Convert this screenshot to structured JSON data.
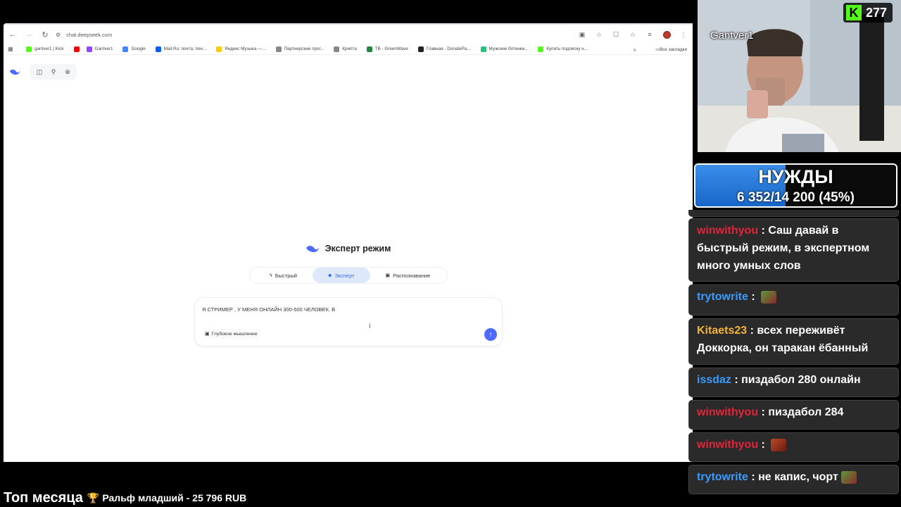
{
  "browser": {
    "url": "chat.deepseek.com",
    "bookmarks": [
      {
        "label": "gantver1 | Kick",
        "color": "#53fc18"
      },
      {
        "label": "",
        "color": "#ff0000"
      },
      {
        "label": "Gantver1",
        "color": "#9146ff"
      },
      {
        "label": "Google",
        "color": "#4285f4"
      },
      {
        "label": "Mail.Ru: почта, пои...",
        "color": "#005ff9"
      },
      {
        "label": "Яндекс Музыка —...",
        "color": "#ffcc00"
      },
      {
        "label": "Партнерские прог...",
        "color": "#888888"
      },
      {
        "label": "Крипта",
        "color": "#888888"
      },
      {
        "label": "TB - GreenWave",
        "color": "#1f8a3d"
      },
      {
        "label": "Главная - DonatePa...",
        "color": "#222222"
      },
      {
        "label": "Мужские ботинки...",
        "color": "#26c281"
      },
      {
        "label": "Купить подписку н...",
        "color": "#53fc18"
      }
    ],
    "all_bookmarks": "Все закладки"
  },
  "deepseek": {
    "hero_title": "Эксперт режим",
    "modes": [
      {
        "label": "Быстрый",
        "icon": "lightning-icon",
        "active": false
      },
      {
        "label": "Эксперт",
        "icon": "diamond-icon",
        "active": true
      },
      {
        "label": "Распознавание",
        "icon": "image-icon",
        "active": false
      }
    ],
    "composer_text": "Я СТРИМЕР , У МЕНЯ ОНЛАЙН 300-500 ЧЕЛОВЕК. В",
    "deep_thinking": "Глубокое мышление",
    "send_color": "#4d6bfe"
  },
  "stream": {
    "streamer_name": "Gantver1",
    "viewer_count": "277",
    "goal_title": "НУЖДЫ",
    "goal_progress_text": "6 352/14 200 (45%)",
    "goal_fraction": 0.45,
    "goal_color": "#2a7ddc",
    "ticker_title": "Топ месяца",
    "ticker_text": "Ральф младший - 25 796 RUB"
  },
  "chat": [
    {
      "user": "winwithyou",
      "color": "#e0263a",
      "text": "Саш давай в быстрый режим, в экспертном много умных слов",
      "emote": ""
    },
    {
      "user": "trytowrite",
      "color": "#3a9bff",
      "text": "",
      "emote": "pepe"
    },
    {
      "user": "Kitaets23",
      "color": "#f2b53a",
      "text": "всех переживёт Доккорка, он таракан ёбанный",
      "emote": ""
    },
    {
      "user": "issdaz",
      "color": "#3a9bff",
      "text": "пиздабол 280 онлайн",
      "emote": ""
    },
    {
      "user": "winwithyou",
      "color": "#e0263a",
      "text": "пиздабол 284",
      "emote": ""
    },
    {
      "user": "winwithyou",
      "color": "#e0263a",
      "text": "",
      "emote": "face"
    },
    {
      "user": "trytowrite",
      "color": "#3a9bff",
      "text": "не капис, чорт",
      "emote": "pepe"
    }
  ]
}
